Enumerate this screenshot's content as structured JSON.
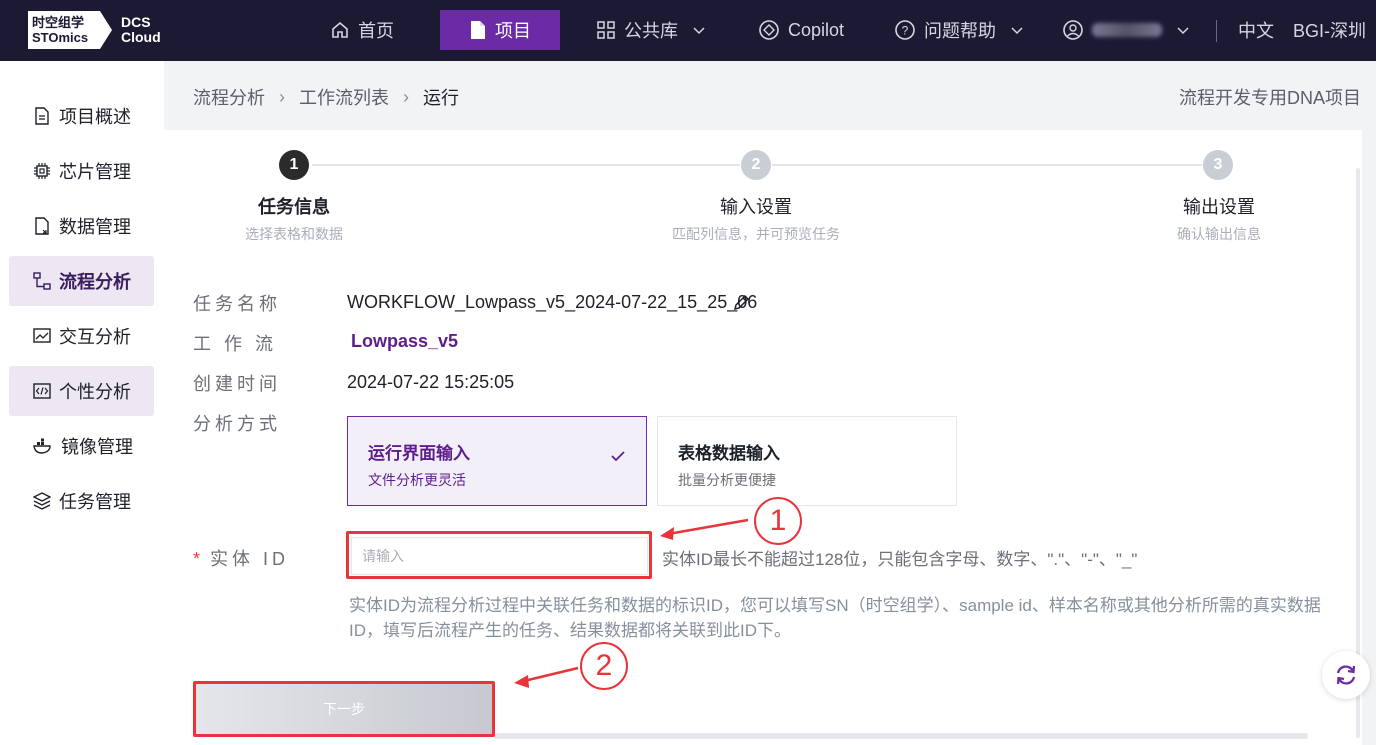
{
  "brand": {
    "logo_cn": "时空组学",
    "logo_en": "STOmics",
    "product_line1": "DCS",
    "product_line2": "Cloud"
  },
  "topnav": {
    "home": "首页",
    "project": "项目",
    "public_lib": "公共库",
    "copilot": "Copilot",
    "help": "问题帮助",
    "language": "中文",
    "region": "BGI-深圳"
  },
  "sidebar": {
    "items": [
      {
        "label": "项目概述",
        "icon": "document-icon"
      },
      {
        "label": "芯片管理",
        "icon": "chip-icon"
      },
      {
        "label": "数据管理",
        "icon": "file-data-icon"
      },
      {
        "label": "流程分析",
        "icon": "workflow-icon"
      },
      {
        "label": "交互分析",
        "icon": "interactive-icon"
      },
      {
        "label": "个性分析",
        "icon": "code-icon"
      },
      {
        "label": "镜像管理",
        "icon": "docker-icon"
      },
      {
        "label": "任务管理",
        "icon": "layers-icon"
      }
    ]
  },
  "breadcrumb": {
    "items": [
      "流程分析",
      "工作流列表",
      "运行"
    ],
    "project_name": "流程开发专用DNA项目"
  },
  "steps": [
    {
      "num": "1",
      "title": "任务信息",
      "sub": "选择表格和数据"
    },
    {
      "num": "2",
      "title": "输入设置",
      "sub": "匹配列信息，并可预览任务"
    },
    {
      "num": "3",
      "title": "输出设置",
      "sub": "确认输出信息"
    }
  ],
  "form": {
    "task_name_label": "任务名称",
    "task_name": "WORKFLOW_Lowpass_v5_2024-07-22_15_25_06",
    "workflow_label": "工 作 流",
    "workflow": "Lowpass_v5",
    "created_label": "创建时间",
    "created": "2024-07-22 15:25:05",
    "mode_label": "分析方式",
    "options": [
      {
        "title": "运行界面输入",
        "sub": "文件分析更灵活"
      },
      {
        "title": "表格数据输入",
        "sub": "批量分析更便捷"
      }
    ],
    "entity_star": "*",
    "entity_label": "实体 ID",
    "entity_placeholder": "请输入",
    "entity_hint": "实体ID最长不能超过128位，只能包含字母、数字、\".\"、\"-\"、\"_\"",
    "entity_desc": "实体ID为流程分析过程中关联任务和数据的标识ID，您可以填写SN（时空组学）、sample id、样本名称或其他分析所需的真实数据ID，填写后流程产生的任务、结果数据都将关联到此ID下。",
    "next_label": "下一步"
  },
  "annotations": {
    "callout1": "1",
    "callout2": "2",
    "highlight_color": "#e8343a"
  },
  "colors": {
    "brand_purple": "#6b2aa6",
    "topbar": "#1c1a33"
  }
}
